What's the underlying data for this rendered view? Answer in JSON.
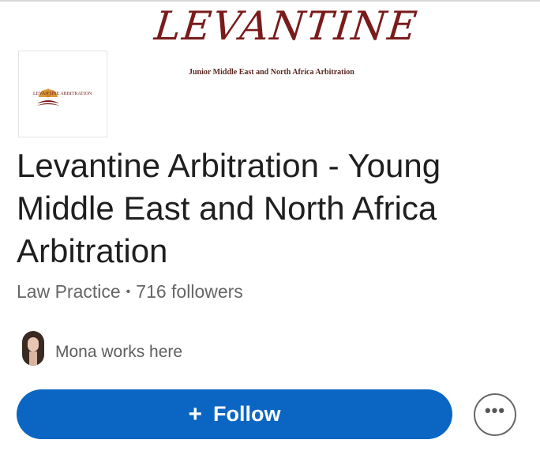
{
  "banner": {
    "title": "LEVANTINE",
    "subtitle": "Junior Middle East and North Africa Arbitration"
  },
  "logo": {
    "text": "LEVANTINE ARBITRATION",
    "color": "#7a1b1b"
  },
  "company": {
    "name": "Levantine Arbitration - Young Middle East and North Africa Arbitration",
    "industry": "Law Practice",
    "separator": "•",
    "followers": "716 followers"
  },
  "insight": {
    "text": "Mona works here",
    "avatar_icon": "person-avatar"
  },
  "actions": {
    "follow_icon": "+",
    "follow_label": "Follow",
    "more_icon": "•••"
  },
  "colors": {
    "primary": "#0a66c2",
    "banner": "#7a1b1b"
  }
}
